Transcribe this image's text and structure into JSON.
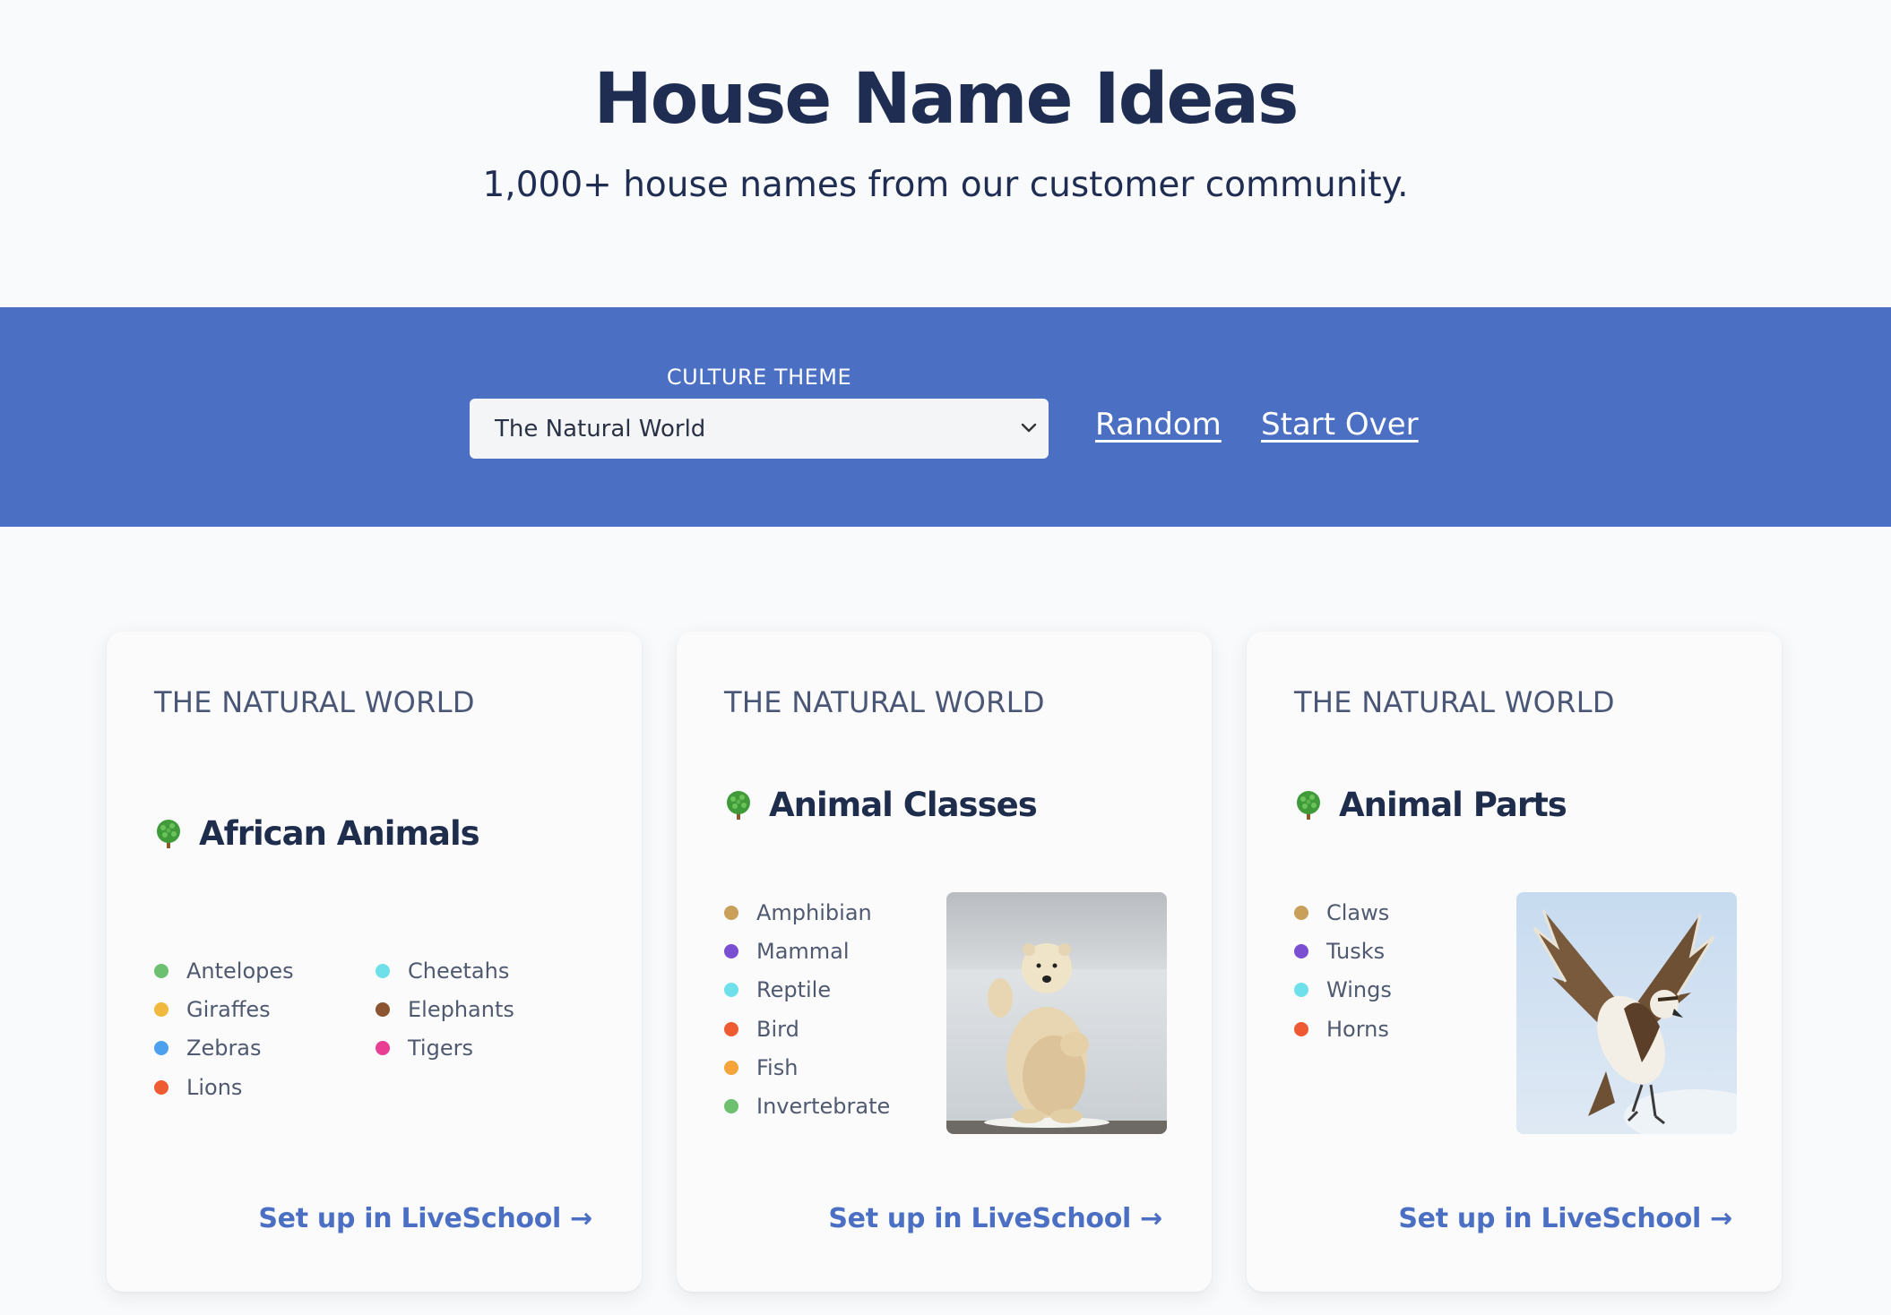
{
  "header": {
    "title": "House Name Ideas",
    "subtitle": "1,000+ house names from our customer community."
  },
  "filter_bar": {
    "label": "CULTURE THEME",
    "selected_theme": "The Natural World",
    "random_link": "Random",
    "start_over_link": "Start Over"
  },
  "cards": [
    {
      "eyebrow": "THE NATURAL WORLD",
      "title": "African Animals",
      "items": [
        {
          "label": "Antelopes",
          "color": "#6cc070"
        },
        {
          "label": "Giraffes",
          "color": "#f0b93d"
        },
        {
          "label": "Zebras",
          "color": "#4ca0ee"
        },
        {
          "label": "Lions",
          "color": "#ee5a32"
        },
        {
          "label": "Cheetahs",
          "color": "#6ee0ea"
        },
        {
          "label": "Elephants",
          "color": "#8a5530"
        },
        {
          "label": "Tigers",
          "color": "#e83f92"
        }
      ],
      "cta": "Set up in LiveSchool →"
    },
    {
      "eyebrow": "THE NATURAL WORLD",
      "title": "Animal Classes",
      "items": [
        {
          "label": "Amphibian",
          "color": "#c8a05a"
        },
        {
          "label": "Mammal",
          "color": "#7a4fd1"
        },
        {
          "label": "Reptile",
          "color": "#6ee0ea"
        },
        {
          "label": "Bird",
          "color": "#ee5a32"
        },
        {
          "label": "Fish",
          "color": "#f4a43a"
        },
        {
          "label": "Invertebrate",
          "color": "#6cc070"
        }
      ],
      "image": "polar-bear-photo",
      "cta": "Set up in LiveSchool →"
    },
    {
      "eyebrow": "THE NATURAL WORLD",
      "title": "Animal Parts",
      "items": [
        {
          "label": "Claws",
          "color": "#c8a05a"
        },
        {
          "label": "Tusks",
          "color": "#7a4fd1"
        },
        {
          "label": "Wings",
          "color": "#6ee0ea"
        },
        {
          "label": "Horns",
          "color": "#ee5a32"
        }
      ],
      "image": "osprey-photo",
      "cta": "Set up in LiveSchool →"
    }
  ],
  "colors": {
    "accent": "#4a6fc3",
    "heading": "#1f2d52",
    "background": "#f9fafb"
  },
  "icons": {
    "card_title_icon": "tree-icon",
    "select_icon": "chevron-down-icon"
  }
}
